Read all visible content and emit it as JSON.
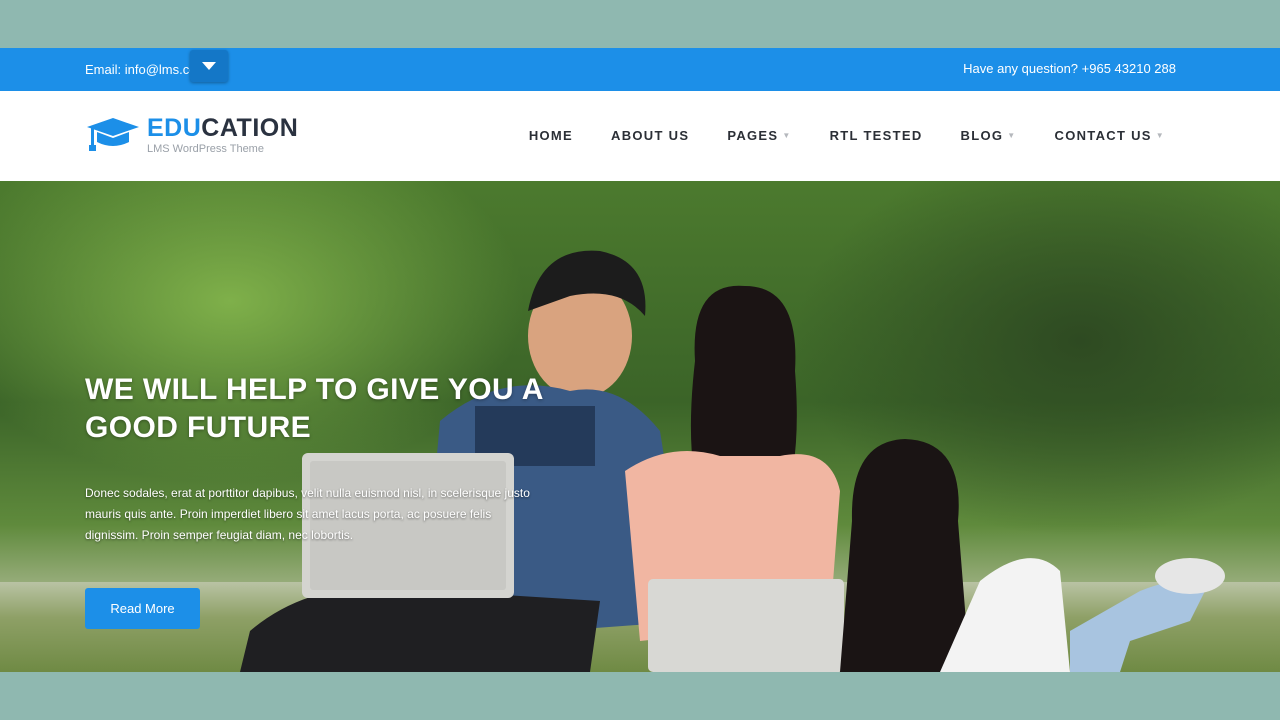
{
  "topbar": {
    "email": "Email: info@lms.com",
    "question": "Have any question? +965 43210 288",
    "toggle_icon": "chevron-down-icon"
  },
  "header": {
    "logo_part1": "EDU",
    "logo_part2": "CATION",
    "tagline": "LMS WordPress Theme",
    "logo_icon": "graduation-cap-icon"
  },
  "nav": {
    "items": [
      {
        "label": "HOME"
      },
      {
        "label": "ABOUT US"
      },
      {
        "label": "PAGES"
      },
      {
        "label": "RTL TESTED"
      },
      {
        "label": "BLOG"
      },
      {
        "label": "CONTACT US"
      }
    ]
  },
  "hero": {
    "title": "WE WILL HELP TO GIVE YOU A GOOD FUTURE",
    "paragraph": "Donec sodales, erat at porttitor dapibus, velit nulla euismod nisl, in scelerisque justo mauris quis ante. Proin imperdiet libero sit amet lacus porta, ac posuere felis dignissim. Proin semper feugiat diam, nec lobortis.",
    "button_label": "Read More"
  },
  "colors": {
    "accent": "#1c8fe8",
    "page_background": "#8fb8b0",
    "nav_text": "#2b2f36"
  }
}
